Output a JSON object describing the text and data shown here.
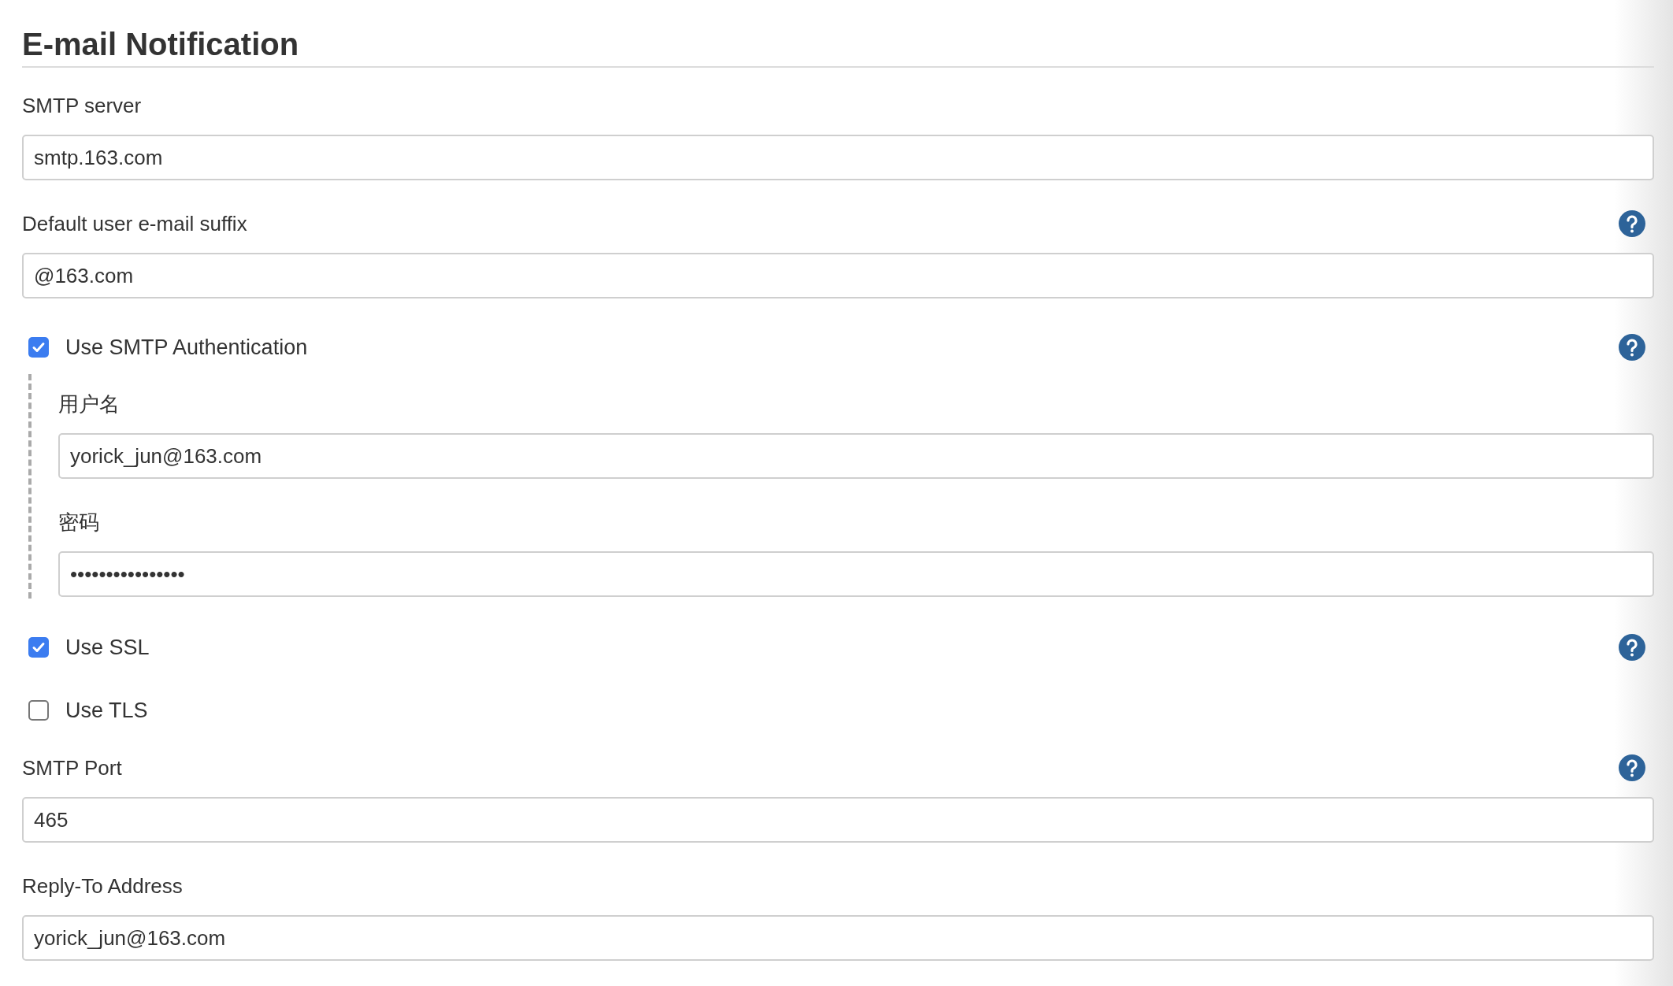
{
  "section": {
    "title": "E-mail Notification"
  },
  "fields": [
    {
      "kind": "text",
      "label": "SMTP server",
      "value": "smtp.163.com",
      "help": false
    },
    {
      "kind": "text",
      "label": "Default user e-mail suffix",
      "value": "@163.com",
      "help": true
    },
    {
      "kind": "checkbox",
      "label": "Use SMTP Authentication",
      "checked": true,
      "help": true,
      "children": [
        {
          "kind": "text",
          "label": "用户名",
          "value": "yorick_jun@163.com",
          "help": false
        },
        {
          "kind": "text",
          "label": "密码",
          "value": "••••••••••••••••",
          "help": false
        }
      ]
    },
    {
      "kind": "checkbox",
      "label": "Use SSL",
      "checked": true,
      "help": true
    },
    {
      "kind": "checkbox",
      "label": "Use TLS",
      "checked": false,
      "help": false
    },
    {
      "kind": "text",
      "label": "SMTP Port",
      "value": "465",
      "help": true
    },
    {
      "kind": "text",
      "label": "Reply-To Address",
      "value": "yorick_jun@163.com",
      "help": false
    }
  ]
}
